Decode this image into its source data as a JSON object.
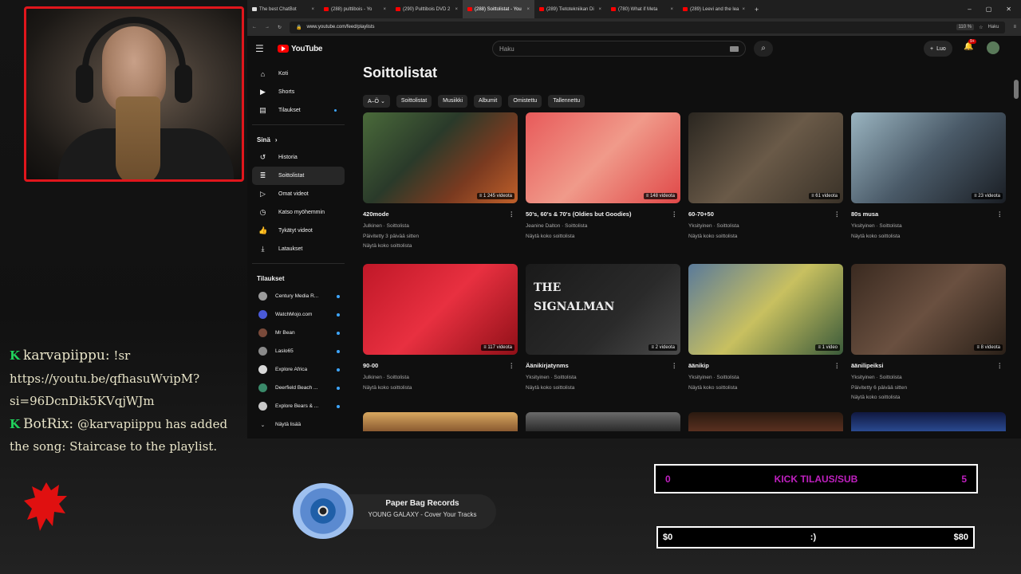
{
  "browser": {
    "tabs": [
      {
        "label": "The best ChatBot"
      },
      {
        "label": "(288) pulttibois - Yo"
      },
      {
        "label": "(290) Pulttibois DVD 2"
      },
      {
        "label": "(288) Soittolistat - You"
      },
      {
        "label": "(289) Tietotekniikan Di"
      },
      {
        "label": "(780) What if Meta"
      },
      {
        "label": "(289) Leevi and the lea"
      }
    ],
    "url": "www.youtube.com/feed/playlists",
    "zoom": "110 %",
    "side_search": "Haku"
  },
  "youtube": {
    "logo_text": "YouTube",
    "search_placeholder": "Haku",
    "create_label": "Luo",
    "notif_count": "9+",
    "sidebar": {
      "main": [
        {
          "label": "Koti",
          "icon": "home-icon"
        },
        {
          "label": "Shorts",
          "icon": "shorts-icon"
        },
        {
          "label": "Tilaukset",
          "icon": "subscriptions-icon"
        }
      ],
      "you_heading": "Sinä",
      "you": [
        {
          "label": "Historia",
          "icon": "history-icon"
        },
        {
          "label": "Soittolistat",
          "icon": "playlists-icon"
        },
        {
          "label": "Omat videot",
          "icon": "my-videos-icon"
        },
        {
          "label": "Katso myöhemmin",
          "icon": "watch-later-icon"
        },
        {
          "label": "Tykätyt videot",
          "icon": "liked-icon"
        },
        {
          "label": "Lataukset",
          "icon": "downloads-icon"
        }
      ],
      "subs_heading": "Tilaukset",
      "subs": [
        {
          "label": "Century Media R...",
          "color": "#9a9a9a"
        },
        {
          "label": "WatchMojo.com",
          "color": "#4a5ad8"
        },
        {
          "label": "Mr Bean",
          "color": "#7a4a3a"
        },
        {
          "label": "Laslo65",
          "color": "#8a8a8a"
        },
        {
          "label": "Explore Africa",
          "color": "#d8d8d8"
        },
        {
          "label": "Deerfield Beach ...",
          "color": "#3a8a6a"
        },
        {
          "label": "Explore Bears & ...",
          "color": "#c8c8c8"
        }
      ],
      "show_more": "Näytä lisää"
    },
    "page_title": "Soittolistat",
    "chips": [
      "A–Ö",
      "Soittolistat",
      "Musiikki",
      "Albumit",
      "Omistettu",
      "Tallennettu"
    ],
    "playlists": [
      {
        "title": "420mode",
        "count": "1 245 videota",
        "meta1": "Julkinen · Soittolista",
        "meta2": "Päivitetty 3 päivää sitten",
        "view": "Näytä koko soittolista",
        "bg": "linear-gradient(135deg,#4a6a3a,#2a3a2a 40%,#7a3a20 70%,#c0602a)"
      },
      {
        "title": "50's, 60's & 70's (Oldies but Goodies)",
        "count": "148 videota",
        "meta1": "Jeanine Dalton · Soittolista",
        "meta2": "",
        "view": "Näytä koko soittolista",
        "bg": "linear-gradient(135deg,#e85a5a,#f09a8a 50%,#e04848)"
      },
      {
        "title": "60-70+50",
        "count": "61 videota",
        "meta1": "Yksityinen · Soittolista",
        "meta2": "",
        "view": "Näytä koko soittolista",
        "bg": "linear-gradient(135deg,#2a2620,#6a5a48 50%,#3a3228)"
      },
      {
        "title": "80s musa",
        "count": "23 videota",
        "meta1": "Yksityinen · Soittolista",
        "meta2": "",
        "view": "Näytä koko soittolista",
        "bg": "linear-gradient(135deg,#9ab4c0,#4a5a68 50%,#1a1e24)"
      },
      {
        "title": "90-00",
        "count": "117 videota",
        "meta1": "Julkinen · Soittolista",
        "meta2": "",
        "view": "Näytä koko soittolista",
        "bg": "linear-gradient(135deg,#c01828,#e83040 50%,#901018)"
      },
      {
        "title": "Äänikirjatynms",
        "count": "2 videota",
        "meta1": "Yksityinen · Soittolista",
        "meta2": "",
        "view": "Näytä koko soittolista",
        "bg": "linear-gradient(135deg,#1a1a1a,#2a2a2a 60%,#4a4a4a)",
        "overlay": "THE SIGNALMAN"
      },
      {
        "title": "äänikip",
        "count": "1 video",
        "meta1": "Yksityinen · Soittolista",
        "meta2": "",
        "view": "Näytä koko soittolista",
        "bg": "linear-gradient(135deg,#5a7a9a,#c8c060 50%,#3a5a3a)"
      },
      {
        "title": "äänilipeiksi",
        "count": "8 videota",
        "meta1": "Yksityinen · Soittolista",
        "meta2": "Päivitetty 6 päivää sitten",
        "view": "Näytä koko soittolista",
        "bg": "linear-gradient(135deg,#3a2a20,#6a5040 50%,#2a2018)"
      }
    ]
  },
  "overlay": {
    "chat": [
      {
        "user": "karvapiippu:",
        "msg": "!sr https://youtu.be/qfhasuWvipM?si=96DcnDik5KVqjWJm"
      },
      {
        "user": "BotRix:",
        "msg": "@karvapiippu has added the song: Staircase to the playlist."
      }
    ],
    "music": {
      "artist": "Paper Bag Records",
      "track": "YOUNG GALAXY - Cover Your Tracks"
    },
    "subgoal": {
      "left": "0",
      "label": "KICK TILAUS/SUB",
      "right": "5"
    },
    "money": {
      "left": "$0",
      "mid": ":)",
      "right": "$80"
    }
  }
}
